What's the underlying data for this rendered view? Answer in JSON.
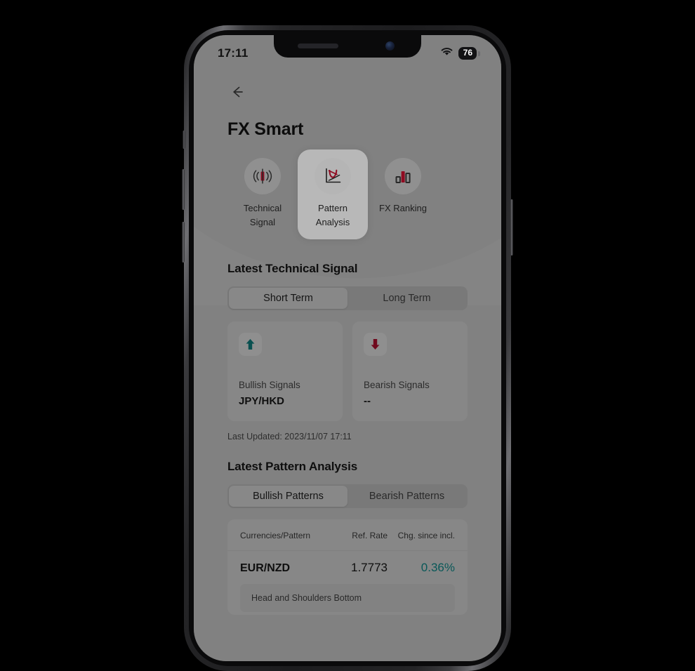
{
  "status_bar": {
    "time": "17:11",
    "wifi_icon": "wifi-icon",
    "battery_level": "76"
  },
  "nav": {
    "back_icon": "back-arrow-icon"
  },
  "header": {
    "title": "FX Smart"
  },
  "tiles": [
    {
      "label": "Technical\nSignal",
      "icon": "candlestick-signal-icon",
      "active": false
    },
    {
      "label": "Pattern\nAnalysis",
      "icon": "pattern-chart-icon",
      "active": true
    },
    {
      "label": "FX Ranking",
      "icon": "bar-ranking-icon",
      "active": false
    }
  ],
  "technical_signal": {
    "section_title": "Latest Technical Signal",
    "tabs": [
      {
        "label": "Short Term",
        "active": true
      },
      {
        "label": "Long Term",
        "active": false
      }
    ],
    "cards": [
      {
        "icon": "arrow-up-icon",
        "label": "Bullish Signals",
        "value": "JPY/HKD",
        "color": "#0d7070"
      },
      {
        "icon": "arrow-down-icon",
        "label": "Bearish Signals",
        "value": "--",
        "color": "#9c0f2a"
      }
    ],
    "last_updated": "Last Updated: 2023/11/07 17:11"
  },
  "pattern_analysis": {
    "section_title": "Latest Pattern Analysis",
    "tabs": [
      {
        "label": "Bullish Patterns",
        "active": true
      },
      {
        "label": "Bearish Patterns",
        "active": false
      }
    ],
    "table": {
      "headers": {
        "pattern": "Currencies/Pattern",
        "rate": "Ref. Rate",
        "change": "Chg. since incl."
      },
      "rows": [
        {
          "pair": "EUR/NZD",
          "rate": "1.7773",
          "change": "0.36%",
          "change_color": "#0d7a7a",
          "pattern": "Head and Shoulders Bottom"
        }
      ]
    }
  },
  "colors": {
    "screen_bg": "#b3b3b3",
    "accent_red": "#c8102e",
    "teal": "#0d7a7a",
    "crimson": "#9c0f2a"
  }
}
